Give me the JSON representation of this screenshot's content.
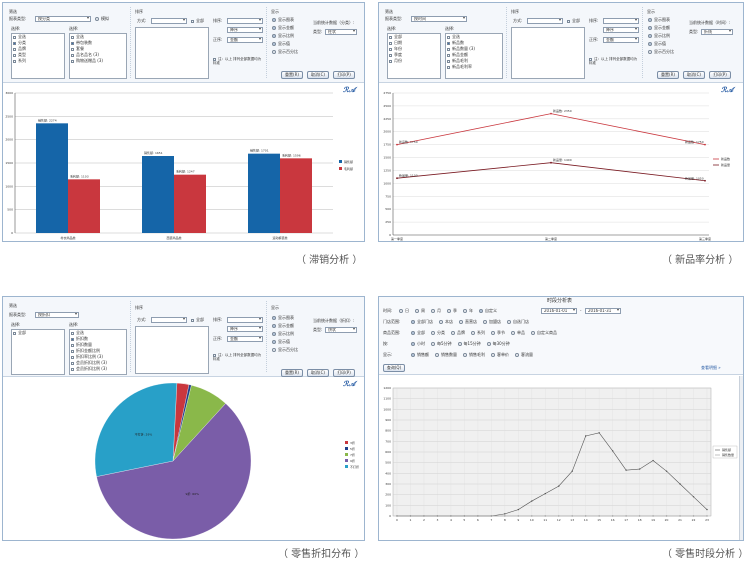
{
  "panel_sales": {
    "filter": {
      "title": "筛选",
      "type_label": "报表类型:",
      "type_value": "按分类",
      "option_label": "模拟",
      "col1_label": "选择:",
      "col2_label": "选择:",
      "col1_items": [
        "全选",
        "分类",
        "品牌",
        "类型",
        "系列"
      ],
      "col2_items": [
        "全选",
        "带包装数",
        "套餐",
        "品名品名 (3)",
        "购物送赠品 (3)"
      ]
    },
    "sort": {
      "title": "排序",
      "method_label": "方式:",
      "all_label": "全部",
      "sort_label": "排序:",
      "order_label": "正序:",
      "sort_value": "降序",
      "order_value": "金额",
      "note": "注：以上 排列全部数据均为 标准"
    },
    "display": {
      "title": "显示",
      "items": [
        "显示图表",
        "显示金额",
        "显示比例",
        "显示值",
        "显示百分比"
      ],
      "right_label": "当前统计数据（分类）:",
      "mode_label": "类型:",
      "mode_value": "柱状"
    },
    "buttons": [
      "重置(R)",
      "取消(C)",
      "打印(P)"
    ]
  },
  "chart_sales": {
    "type": "bar",
    "categories": [
      "衬衣商品类",
      "西装商品类",
      "运动裤装类"
    ],
    "series": [
      {
        "name": "销售额",
        "color": "#1565a8",
        "values": [
          2350,
          1650,
          1700
        ],
        "labels": [
          "销售额: 2274",
          "销售额: 1651",
          "销售额: 1701"
        ]
      },
      {
        "name": "毛利额",
        "color": "#c9373e",
        "values": [
          1150,
          1250,
          1600
        ],
        "labels": [
          "毛利额: 1103",
          "毛利额: 1247",
          "毛利额: 1596"
        ]
      }
    ],
    "y_ticks": [
      "3000",
      "2500",
      "2000",
      "1500",
      "1000",
      "500",
      "0"
    ],
    "ylim": [
      0,
      3000
    ],
    "legend": [
      "销售额",
      "毛利额"
    ]
  },
  "caption_sales": "（ 滞销分析 ）",
  "panel_new": {
    "filter": {
      "title": "筛选",
      "type_label": "报表类型:",
      "type_value": "按时间",
      "col1_label": "选择:",
      "col2_label": "选择:",
      "col1_items": [
        "全部",
        "日期",
        "年份",
        "季度",
        "月份"
      ],
      "col2_items": [
        "全选",
        "新品数",
        "新品数量 (3)",
        "新品金额",
        "新品毛利",
        "新品毛利率"
      ]
    },
    "sort": {
      "title": "排序",
      "method_label": "方式:",
      "all_label": "全部",
      "sort_label": "排序:",
      "order_label": "正序:",
      "sort_value": "降序",
      "order_value": "金额",
      "note": "注：以上 排列全部数据均为 标准"
    },
    "display": {
      "title": "显示",
      "items": [
        "显示图表",
        "显示金额",
        "显示比例",
        "显示值",
        "显示百分比"
      ],
      "right_label": "当前统计数据（时间）:",
      "mode_label": "类型:",
      "mode_value": "折线"
    },
    "buttons": [
      "重置(R)",
      "取消(C)",
      "打印(P)"
    ]
  },
  "chart_new": {
    "type": "line",
    "categories": [
      "第一季度",
      "第二季度",
      "第三季度"
    ],
    "series": [
      {
        "name": "新品数",
        "color": "#c9373e",
        "values": [
          1750,
          2350,
          1750
        ],
        "labels": [
          "新品数: 1750",
          "新品数: 2350",
          "新品数: 1750"
        ]
      },
      {
        "name": "新品量",
        "color": "#7a1b23",
        "values": [
          1100,
          1400,
          1050
        ],
        "labels": [
          "新品量: 1100",
          "新品量: 1400",
          "新品量: 1050"
        ]
      }
    ],
    "y_ticks": [
      "2750",
      "2500",
      "2250",
      "2000",
      "1750",
      "1500",
      "1250",
      "1000",
      "750",
      "500",
      "250",
      "0"
    ],
    "ylim": [
      0,
      2750
    ],
    "legend": [
      "新品数",
      "新品量"
    ]
  },
  "caption_new": "（ 新品率分析 ）",
  "panel_discount": {
    "filter": {
      "title": "筛选",
      "type_label": "报表类型:",
      "type_value": "按折扣",
      "col1_label": "选择:",
      "col2_label": "选择:",
      "col1_items": [
        "全部"
      ],
      "col2_items": [
        "全选",
        "折扣数",
        "折扣数量",
        "折扣金额比例",
        "折扣率比例 (3)",
        "会员折扣比例 (3)",
        "会员折扣比例 (3)"
      ]
    },
    "sort": {
      "title": "排序",
      "method_label": "方式:",
      "all_label": "全部",
      "sort_label": "排序:",
      "order_label": "正序:",
      "sort_value": "降序",
      "order_value": "金额",
      "note": "注：以上 排列全部数据均为 标准"
    },
    "display": {
      "title": "显示",
      "items": [
        "显示图表",
        "显示金额",
        "显示比例",
        "显示值",
        "显示百分比"
      ],
      "right_label": "当前统计数据（折扣）:",
      "mode_label": "类型:",
      "mode_value": "饼状"
    },
    "buttons": [
      "重置(R)",
      "取消(C)",
      "打印(P)"
    ]
  },
  "chart_discount": {
    "type": "pie",
    "slices": [
      {
        "name": "3折",
        "value": 2.5,
        "color": "#c9373e",
        "label": ""
      },
      {
        "name": "5折",
        "value": 0.5,
        "color": "#1e3f8a",
        "label": ""
      },
      {
        "name": "7折",
        "value": 8,
        "color": "#8ab84a",
        "label": ""
      },
      {
        "name": "9折",
        "value": 60,
        "color": "#7a5da8",
        "label": "9折: 60%"
      },
      {
        "name": "不打折",
        "value": 29,
        "color": "#28a0c8",
        "label": "不打折: 29%"
      }
    ],
    "legend": [
      "3折",
      "5折",
      "7折",
      "9折",
      "不打折"
    ]
  },
  "caption_discount": "（ 零售折扣分布 ）",
  "panel_time": {
    "title": "时段分析表",
    "time_label": "时间:",
    "period_options": [
      "日",
      "周",
      "月",
      "季",
      "年",
      "自定义"
    ],
    "date_from": "2016-01-01",
    "date_to": "2016-01-31",
    "row2_label": "门店范围:",
    "row2_options": [
      "全部门店",
      "本店",
      "直营店",
      "加盟店",
      "自选门店"
    ],
    "row3_label": "商品范围:",
    "row3_options": [
      "全部",
      "分类",
      "品牌",
      "系列",
      "季节",
      "单品",
      "自定义商品"
    ],
    "row4_label": "按:",
    "row4_options": [
      "小时",
      "每5分钟",
      "每15分钟",
      "每30分钟"
    ],
    "row5_label": "显示:",
    "row5_options": [
      "销售额",
      "销售数量",
      "销售毛利",
      "客单价",
      "客流量"
    ],
    "query_button": "查询(Q)",
    "link": "查看明细 »"
  },
  "chart_time": {
    "type": "line",
    "x": [
      "0",
      "1",
      "2",
      "3",
      "4",
      "5",
      "6",
      "7",
      "8",
      "9",
      "10",
      "11",
      "12",
      "13",
      "14",
      "15",
      "16",
      "17",
      "18",
      "19",
      "20",
      "21",
      "22",
      "23"
    ],
    "series": [
      {
        "name": "销售额",
        "color": "#555555",
        "values": [
          0,
          0,
          0,
          0,
          0,
          0,
          0,
          0,
          20,
          60,
          140,
          210,
          280,
          420,
          750,
          780,
          610,
          430,
          440,
          520,
          420,
          300,
          180,
          60
        ]
      },
      {
        "name": "销售数量",
        "color": "#999999",
        "values": [
          0,
          0,
          0,
          0,
          0,
          0,
          0,
          0,
          0,
          0,
          0,
          0,
          0,
          0,
          0,
          0,
          0,
          0,
          0,
          0,
          0,
          0,
          0,
          0
        ]
      }
    ],
    "y_ticks": [
      "1200",
      "1100",
      "1000",
      "900",
      "800",
      "700",
      "600",
      "500",
      "400",
      "300",
      "200",
      "100",
      "0"
    ],
    "ylim": [
      0,
      1200
    ],
    "legend": [
      "销售额",
      "销售数量"
    ]
  },
  "caption_time": "（ 零售时段分析 ）"
}
